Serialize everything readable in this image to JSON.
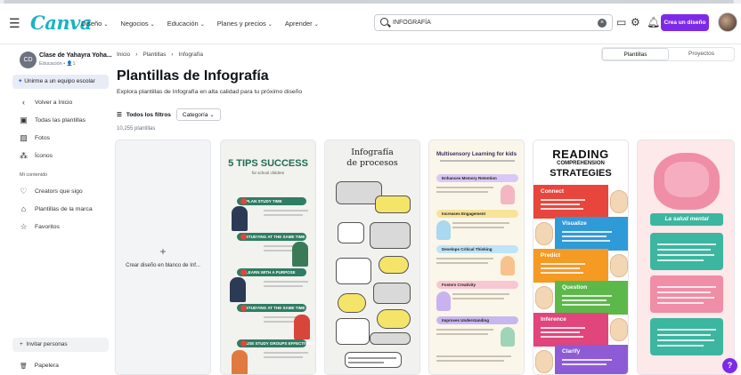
{
  "topbar": {
    "logo": "Canva",
    "menu": [
      {
        "label": "Diseño"
      },
      {
        "label": "Negocios"
      },
      {
        "label": "Educación"
      },
      {
        "label": "Planes y precios"
      },
      {
        "label": "Aprender"
      }
    ],
    "search_value": "INFOGRAFÍA",
    "create_label": "Crea un diseño"
  },
  "sidebar": {
    "team_initials": "CD",
    "team_name": "Clase de Yahayra Yoha...",
    "team_sub": "Educación • 👤1",
    "join_label": "Unirme a un equipo escolar",
    "items": [
      {
        "label": "Volver a Inicio"
      },
      {
        "label": "Todas las plantillas"
      },
      {
        "label": "Fotos"
      },
      {
        "label": "Íconos"
      }
    ],
    "heading": "Mi contenido",
    "content_items": [
      {
        "label": "Creators que sigo"
      },
      {
        "label": "Plantillas de la marca"
      },
      {
        "label": "Favoritos"
      }
    ],
    "invite_label": "Invitar personas",
    "trash_label": "Papelera"
  },
  "main": {
    "breadcrumb": [
      "Inicio",
      "Plantillas",
      "Infografía"
    ],
    "tabs": [
      {
        "label": "Plantillas"
      },
      {
        "label": "Proyectos"
      }
    ],
    "title": "Plantillas de Infografía",
    "subtitle": "Explora plantillas de Infografía en alta calidad para tu próximo diseño",
    "all_filters": "Todos los filtros",
    "category": "Categoría",
    "count": "10,255 plantillas",
    "blank_label": "Crear diseño en blanco de Inf...",
    "cards": {
      "c1_title": "5 TIPS SUCCESS",
      "c1_sub": "for school children",
      "c1_tips": [
        "PLAN STUDY TIME",
        "STUDYING AT THE SAME TIME",
        "LEARN WITH A PURPOSE",
        "STUDYING AT THE SAME TIME",
        "USE STUDY GROUPS EFFECTIVELY"
      ],
      "c2_title1": "Infografía",
      "c2_title2": "de procesos",
      "c3_title": "Multisensory Learning for kids",
      "c3_bands": [
        "Enhances Memory Retention",
        "Increases Engagement",
        "Develops Critical Thinking",
        "Fosters Creativity",
        "Improves Understanding"
      ],
      "c4_title1": "READING",
      "c4_title2": "COMPREHENSION",
      "c4_title3": "STRATEGIES",
      "c4_blocks": [
        "Connect",
        "Visualize",
        "Predict",
        "Question",
        "Inference",
        "Clarify"
      ],
      "c5_banner": "La salud mental"
    }
  },
  "help_label": "?"
}
